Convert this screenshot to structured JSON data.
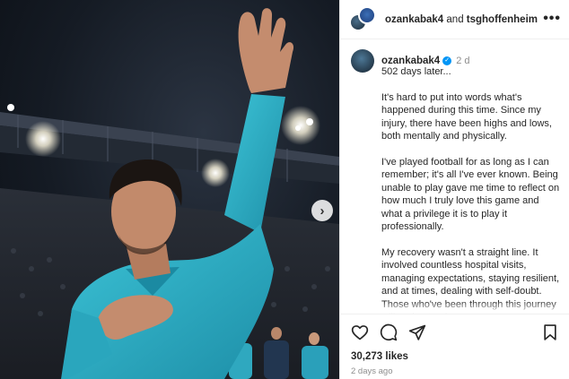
{
  "header": {
    "user1": "ozankabak4",
    "joiner": " and ",
    "user2": "tsghoffenheim",
    "more_glyph": "•••"
  },
  "caption": {
    "username": "ozankabak4",
    "verified_glyph": "✓",
    "time": "2 d",
    "paragraphs": [
      "502 days later...",
      "It's hard to put into words what's happened during this time. Since my injury, there have been highs and lows, both mentally and physically.",
      "I've played football for as long as I can remember; it's all I've ever known. Being unable to play gave me time to reflect on how much I truly love this game and what a privilege it is to play it professionally.",
      "My recovery wasn't a straight line. It involved countless hospital visits, managing expectations, staying resilient, and at times, dealing with self-doubt. Those who've been through this journey will understand"
    ]
  },
  "carousel": {
    "next_glyph": "›"
  },
  "actions": {
    "icons": [
      "heart-icon",
      "comment-icon",
      "share-icon",
      "bookmark-icon"
    ],
    "likes": "30,273 likes",
    "time_ago": "2 days ago"
  },
  "colors": {
    "jersey": "#2fb3c9",
    "verified": "#0095f6",
    "muted_text": "#8e8e8e"
  }
}
